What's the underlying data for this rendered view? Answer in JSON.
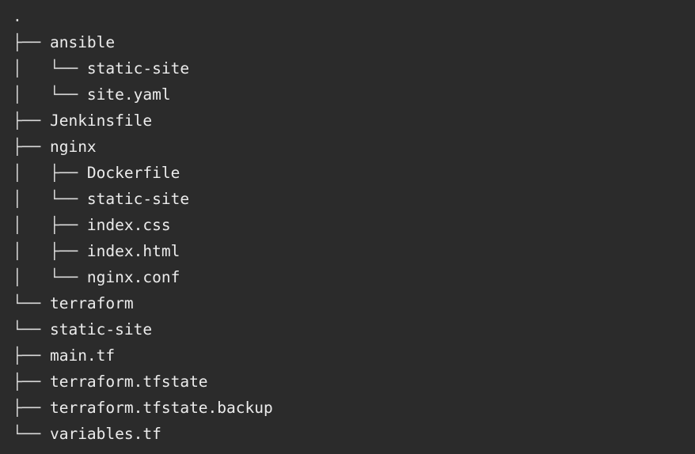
{
  "tree": {
    "lines": [
      {
        "prefix": ".",
        "name": ""
      },
      {
        "prefix": "├── ",
        "name": "ansible"
      },
      {
        "prefix": "│   └── ",
        "name": "static-site"
      },
      {
        "prefix": "│   └── ",
        "name": "site.yaml"
      },
      {
        "prefix": "├── ",
        "name": "Jenkinsfile"
      },
      {
        "prefix": "├── ",
        "name": "nginx"
      },
      {
        "prefix": "│   ├── ",
        "name": "Dockerfile"
      },
      {
        "prefix": "│   └── ",
        "name": "static-site"
      },
      {
        "prefix": "│   ├── ",
        "name": "index.css"
      },
      {
        "prefix": "│   ├── ",
        "name": "index.html"
      },
      {
        "prefix": "│   └── ",
        "name": "nginx.conf"
      },
      {
        "prefix": "└── ",
        "name": "terraform"
      },
      {
        "prefix": "└── ",
        "name": "static-site"
      },
      {
        "prefix": "├── ",
        "name": "main.tf"
      },
      {
        "prefix": "├── ",
        "name": "terraform.tfstate"
      },
      {
        "prefix": "├── ",
        "name": "terraform.tfstate.backup"
      },
      {
        "prefix": "└── ",
        "name": "variables.tf"
      }
    ]
  }
}
